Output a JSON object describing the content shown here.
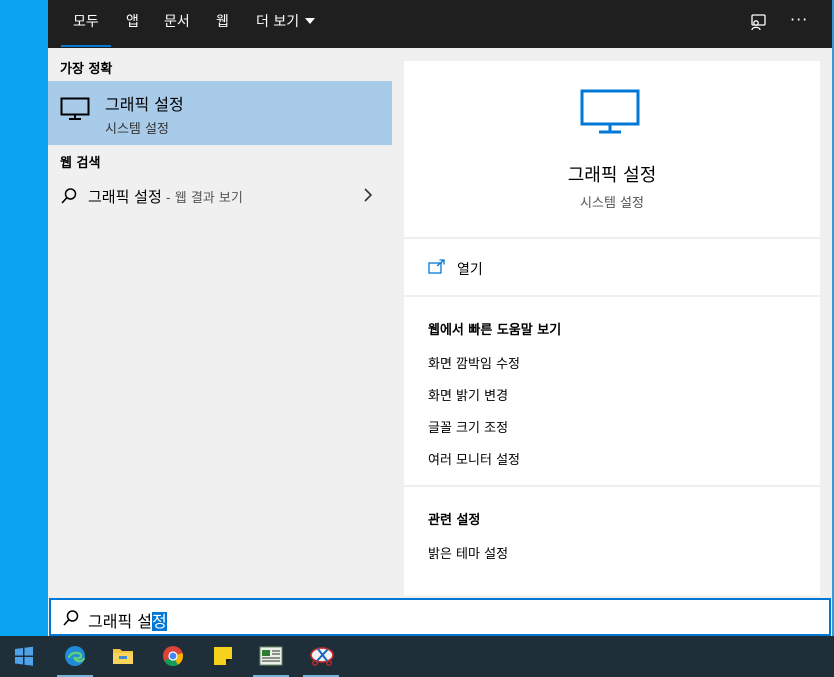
{
  "tabs": [
    {
      "label": "모두"
    },
    {
      "label": "앱"
    },
    {
      "label": "문서"
    },
    {
      "label": "웹"
    },
    {
      "label": "더 보기"
    }
  ],
  "top_icons": [
    "feedback-icon",
    "more-options-icon"
  ],
  "more_label": "···",
  "best_match": {
    "section_title": "가장 정확",
    "title": "그래픽 설정",
    "subtitle": "시스템 설정",
    "icon": "monitor-icon"
  },
  "web_search": {
    "section_title": "웹 검색",
    "query": "그래픽 설정",
    "suffix": " - 웹 결과 보기",
    "icon": "search-icon"
  },
  "preview": {
    "title": "그래픽 설정",
    "subtitle": "시스템 설정",
    "open_label": "열기",
    "help_title": "웹에서 빠른 도움말 보기",
    "help_links": [
      "화면 깜박임 수정",
      "화면 밝기 변경",
      "글꼴 크기 조정",
      "여러 모니터 설정"
    ],
    "related_title": "관련 설정",
    "related_links": [
      "밝은 테마 설정"
    ]
  },
  "search_box": {
    "text_before": "그래픽 설",
    "text_selected": "정"
  },
  "taskbar": {
    "apps": [
      "windows-start-icon",
      "edge-icon",
      "file-explorer-icon",
      "chrome-icon",
      "sticky-notes-icon",
      "news-app-icon",
      "snipping-tool-icon"
    ]
  },
  "colors": {
    "accent": "#0078d7",
    "selected_row": "#a9cbea",
    "topbar": "#1f1f1f",
    "desktop": "#0aa3f0",
    "taskbar": "#1f2f3a"
  }
}
